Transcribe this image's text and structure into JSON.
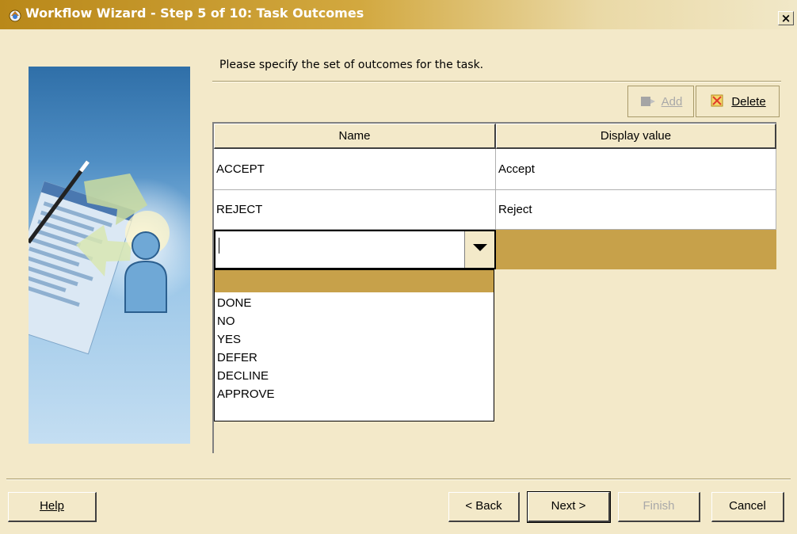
{
  "window": {
    "title": "Workflow Wizard - Step 5 of 10: Task Outcomes",
    "close_symbol": "×"
  },
  "instruction": "Please specify the set of outcomes for the task.",
  "toolbar": {
    "add": {
      "label": "Add",
      "enabled": false,
      "icon": "add-row-icon"
    },
    "delete": {
      "label": "Delete",
      "enabled": true,
      "icon": "delete-icon"
    }
  },
  "table": {
    "columns": [
      "Name",
      "Display value"
    ],
    "rows": [
      {
        "name": "ACCEPT",
        "display": "Accept"
      },
      {
        "name": "REJECT",
        "display": "Reject"
      }
    ],
    "new_row": {
      "name_value": "",
      "display_value": ""
    }
  },
  "dropdown": {
    "selected_index": 0,
    "options": [
      "",
      "DONE",
      "NO",
      "YES",
      "DEFER",
      "DECLINE",
      "APPROVE"
    ]
  },
  "buttons": {
    "help": "Help",
    "back": "< Back",
    "next": "Next >",
    "finish": "Finish",
    "cancel": "Cancel"
  },
  "colors": {
    "accent": "#c7a14a",
    "background": "#f3e9c9",
    "titlebar_start": "#b98819"
  }
}
